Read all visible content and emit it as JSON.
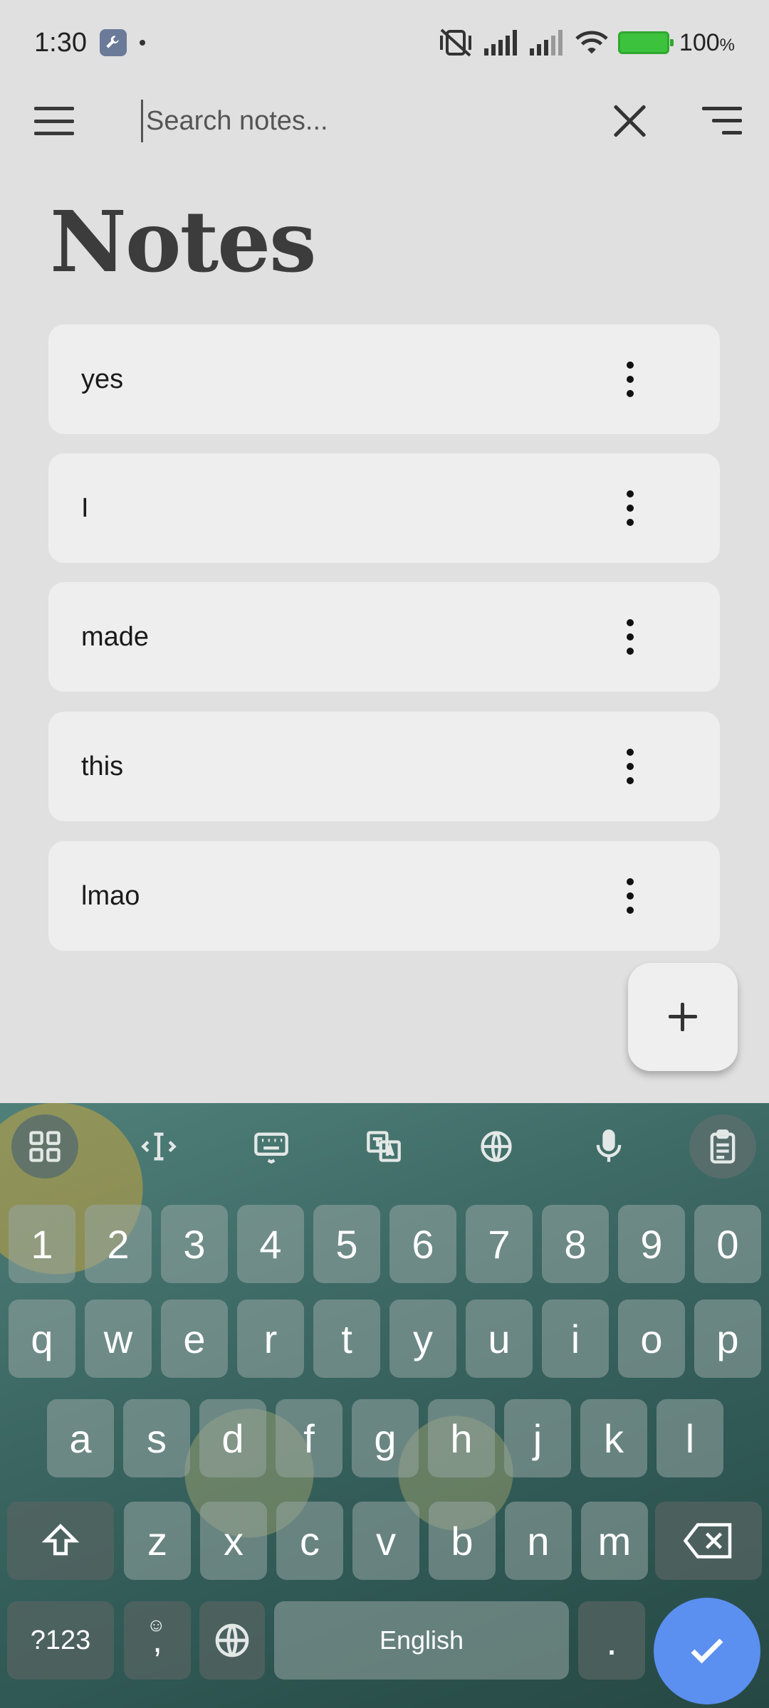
{
  "status_bar": {
    "time": "1:30",
    "battery_percent": "100",
    "battery_unit": "%"
  },
  "search": {
    "placeholder": "Search notes..."
  },
  "page_title": "Notes",
  "notes": [
    "yes",
    "I",
    "made",
    "this",
    "lmao"
  ],
  "keyboard": {
    "number_row": [
      "1",
      "2",
      "3",
      "4",
      "5",
      "6",
      "7",
      "8",
      "9",
      "0"
    ],
    "row1": [
      "q",
      "w",
      "e",
      "r",
      "t",
      "y",
      "u",
      "i",
      "o",
      "p"
    ],
    "row2": [
      "a",
      "s",
      "d",
      "f",
      "g",
      "h",
      "j",
      "k",
      "l"
    ],
    "row3": [
      "z",
      "x",
      "c",
      "v",
      "b",
      "n",
      "m"
    ],
    "symbols_label": "?123",
    "comma_label": ",",
    "space_label": "English",
    "period_label": "."
  },
  "colors": {
    "background": "#e0e0e0",
    "card": "#eeeeee",
    "enter_key": "#5b8ff0"
  }
}
